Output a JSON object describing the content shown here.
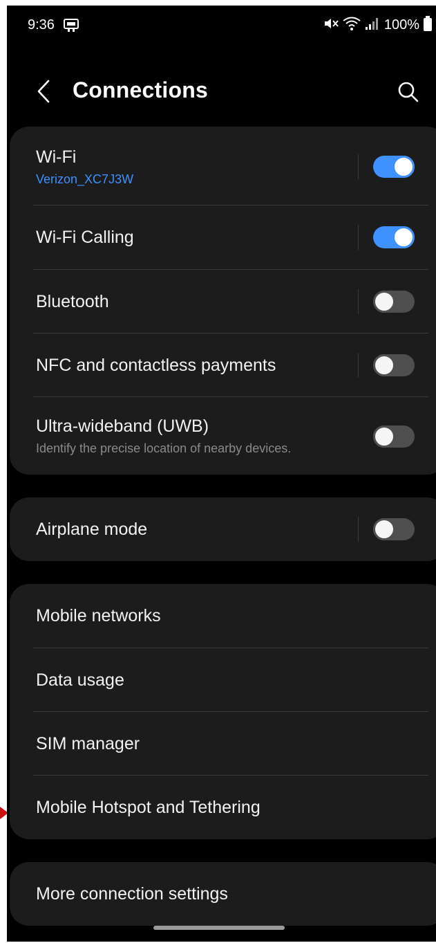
{
  "status_bar": {
    "time": "9:36",
    "battery": "100%"
  },
  "header": {
    "title": "Connections"
  },
  "group1": {
    "wifi": {
      "label": "Wi-Fi",
      "network": "Verizon_XC7J3W",
      "enabled": true
    },
    "wifi_calling": {
      "label": "Wi-Fi Calling",
      "enabled": true
    },
    "bluetooth": {
      "label": "Bluetooth",
      "enabled": false
    },
    "nfc": {
      "label": "NFC and contactless payments",
      "enabled": false
    },
    "uwb": {
      "label": "Ultra-wideband (UWB)",
      "description": "Identify the precise location of nearby devices.",
      "enabled": false
    }
  },
  "group2": {
    "airplane": {
      "label": "Airplane mode",
      "enabled": false
    }
  },
  "group3": {
    "items": [
      {
        "label": "Mobile networks"
      },
      {
        "label": "Data usage"
      },
      {
        "label": "SIM manager"
      },
      {
        "label": "Mobile Hotspot and Tethering"
      }
    ]
  },
  "group4": {
    "more": {
      "label": "More connection settings"
    }
  },
  "colors": {
    "accent": "#3e91ff",
    "background": "#000000",
    "card": "#1c1c1c",
    "pointer": "#cc1111"
  }
}
